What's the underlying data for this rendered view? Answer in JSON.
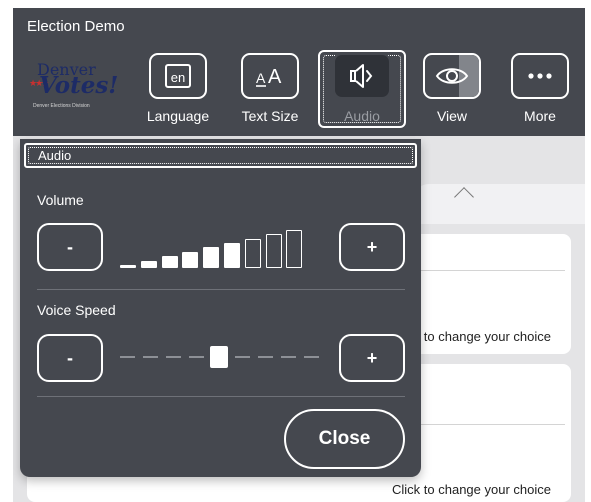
{
  "app": {
    "title": "Election Demo"
  },
  "logo": {
    "line1": "Denver",
    "line2": "Votes!",
    "line3": "Denver Elections Division"
  },
  "toolbar": {
    "items": [
      {
        "label": "Language",
        "icon": "language-icon",
        "badge": "en"
      },
      {
        "label": "Text Size",
        "icon": "text-size-icon",
        "glyph": "AA"
      },
      {
        "label": "Audio",
        "icon": "speaker-icon",
        "active": true
      },
      {
        "label": "View",
        "icon": "eye-icon"
      },
      {
        "label": "More",
        "icon": "more-dots-icon",
        "glyph": "•••"
      }
    ]
  },
  "modal": {
    "title": "Audio",
    "volume": {
      "label": "Volume",
      "decrease_label": "-",
      "increase_label": "+",
      "level": 6,
      "max": 9
    },
    "voice_speed": {
      "label": "Voice Speed",
      "decrease_label": "-",
      "increase_label": "+",
      "position": 5,
      "steps": 9
    },
    "close_label": "Close"
  },
  "background": {
    "cards": [
      {
        "hint": "to change your choice"
      },
      {
        "hint": "Click to change your choice"
      }
    ]
  },
  "colors": {
    "header_bg": "#45484f",
    "page_bg": "#e4e4e6",
    "accent": "#ffffff"
  }
}
